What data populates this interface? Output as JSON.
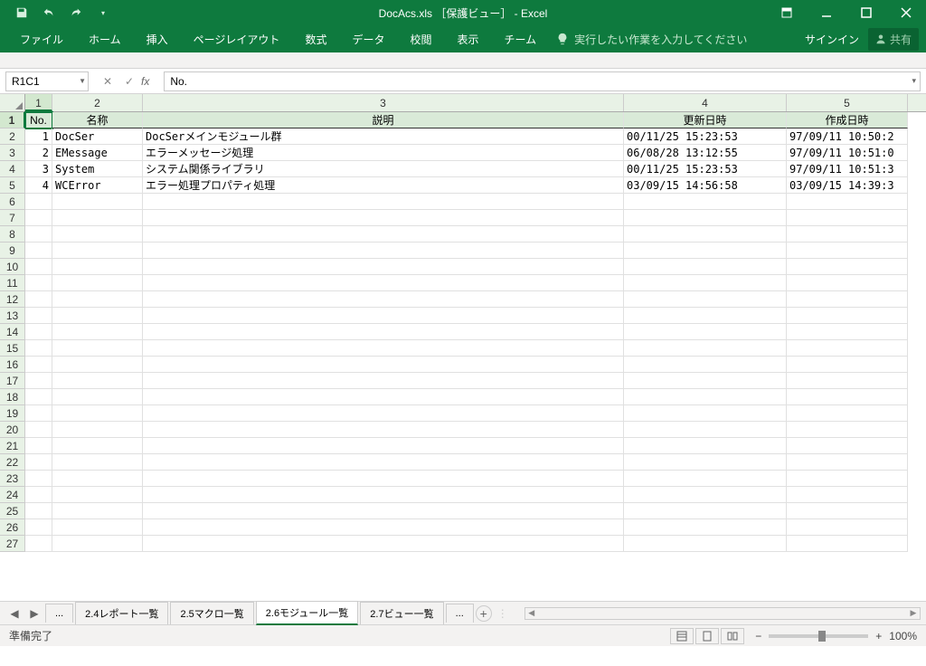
{
  "title": "DocAcs.xls ［保護ビュー］ - Excel",
  "qat": {
    "save": "save",
    "undo": "undo",
    "redo": "redo"
  },
  "ribbon": {
    "tabs": [
      "ファイル",
      "ホーム",
      "挿入",
      "ページレイアウト",
      "数式",
      "データ",
      "校閲",
      "表示",
      "チーム"
    ],
    "tell_me": "実行したい作業を入力してください",
    "signin": "サインイン",
    "share": "共有"
  },
  "formula": {
    "name_box": "R1C1",
    "fx_label": "fx",
    "value": "No."
  },
  "grid": {
    "columns": [
      "1",
      "2",
      "3",
      "4",
      "5"
    ],
    "headers": [
      "No.",
      "名称",
      "説明",
      "更新日時",
      "作成日時"
    ],
    "rows": [
      {
        "no": "1",
        "name": "DocSer",
        "desc": "DocSerメインモジュール群",
        "upd": "00/11/25 15:23:53",
        "crt": "97/09/11 10:50:2"
      },
      {
        "no": "2",
        "name": "EMessage",
        "desc": "エラーメッセージ処理",
        "upd": "06/08/28 13:12:55",
        "crt": "97/09/11 10:51:0"
      },
      {
        "no": "3",
        "name": "System",
        "desc": "システム関係ライブラリ",
        "upd": "00/11/25 15:23:53",
        "crt": "97/09/11 10:51:3"
      },
      {
        "no": "4",
        "name": "WCError",
        "desc": "エラー処理プロパティ処理",
        "upd": "03/09/15 14:56:58",
        "crt": "03/09/15 14:39:3"
      }
    ],
    "row_labels": [
      "1",
      "2",
      "3",
      "4",
      "5",
      "6",
      "7",
      "8",
      "9",
      "10",
      "11",
      "12",
      "13",
      "14",
      "15",
      "16",
      "17",
      "18",
      "19",
      "20",
      "21",
      "22",
      "23",
      "24",
      "25",
      "26",
      "27"
    ]
  },
  "sheets": {
    "ellipsis": "...",
    "tabs": [
      "2.4レポート一覧",
      "2.5マクロ一覧",
      "2.6モジュール一覧",
      "2.7ビュー一覧"
    ],
    "active": 2,
    "add": "+"
  },
  "status": {
    "ready": "準備完了",
    "zoom": "100%"
  }
}
